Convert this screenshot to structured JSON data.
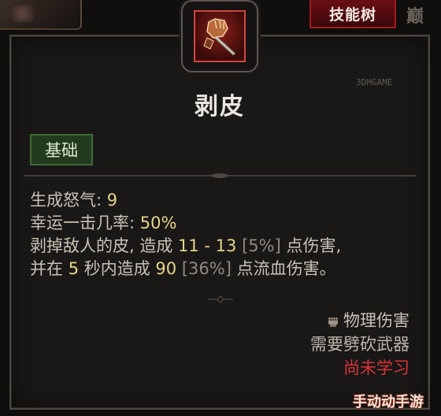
{
  "header": {
    "skilltree_label": "技能树",
    "right_glyph": "巅"
  },
  "skill": {
    "icon": "gauntlet-dagger-icon",
    "name": "剥皮",
    "category": "基础",
    "fury_label": "生成怒气: ",
    "fury_value": "9",
    "lucky_label": "幸运一击几率: ",
    "lucky_value": "50%",
    "desc_line1_pre": "剥掉敌人的皮, 造成 ",
    "desc_line1_val": "11 - 13",
    "desc_line1_bracket": " [5%]",
    "desc_line1_post": " 点伤害,",
    "desc_line2_pre": "并在 ",
    "desc_line2_val1": "5",
    "desc_line2_mid": " 秒内造成 ",
    "desc_line2_val2": "90",
    "desc_line2_bracket": " [36%]",
    "desc_line2_post": " 点流血伤害。",
    "damage_type": "物理伤害",
    "requirement": "需要劈砍武器",
    "status": "尚未学习"
  },
  "colors": {
    "accent_red": "#d8343a",
    "value_gold": "#e5d58a",
    "badge_green": "#233a1f"
  },
  "watermark": {
    "text": "手动动手游",
    "site": "3DMGAME"
  }
}
